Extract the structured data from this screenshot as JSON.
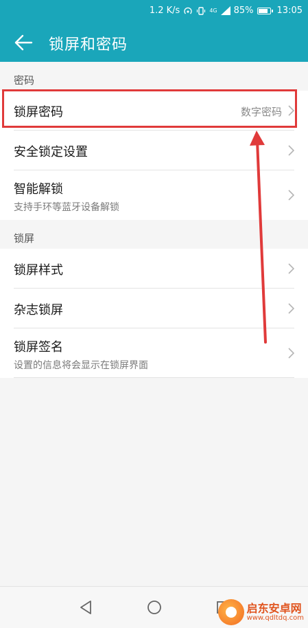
{
  "status_bar": {
    "speed": "1.2 K/s",
    "network": "4G",
    "battery": "85%",
    "battery_level": 0.85,
    "time": "13:05"
  },
  "app_bar": {
    "title": "锁屏和密码",
    "back_icon": "arrow-left-icon"
  },
  "sections": [
    {
      "label": "密码",
      "items": [
        {
          "title": "锁屏密码",
          "value": "数字密码"
        },
        {
          "title": "安全锁定设置"
        },
        {
          "title": "智能解锁",
          "subtitle": "支持手环等蓝牙设备解锁"
        }
      ]
    },
    {
      "label": "锁屏",
      "items": [
        {
          "title": "锁屏样式"
        },
        {
          "title": "杂志锁屏"
        },
        {
          "title": "锁屏签名",
          "subtitle": "设置的信息将会显示在锁屏界面"
        }
      ]
    }
  ],
  "watermark": {
    "name": "启东安卓网",
    "url": "www.qdltdq.com"
  },
  "colors": {
    "accent": "#1aa6ba",
    "highlight": "#e03a3a",
    "background": "#f5f5f5"
  }
}
